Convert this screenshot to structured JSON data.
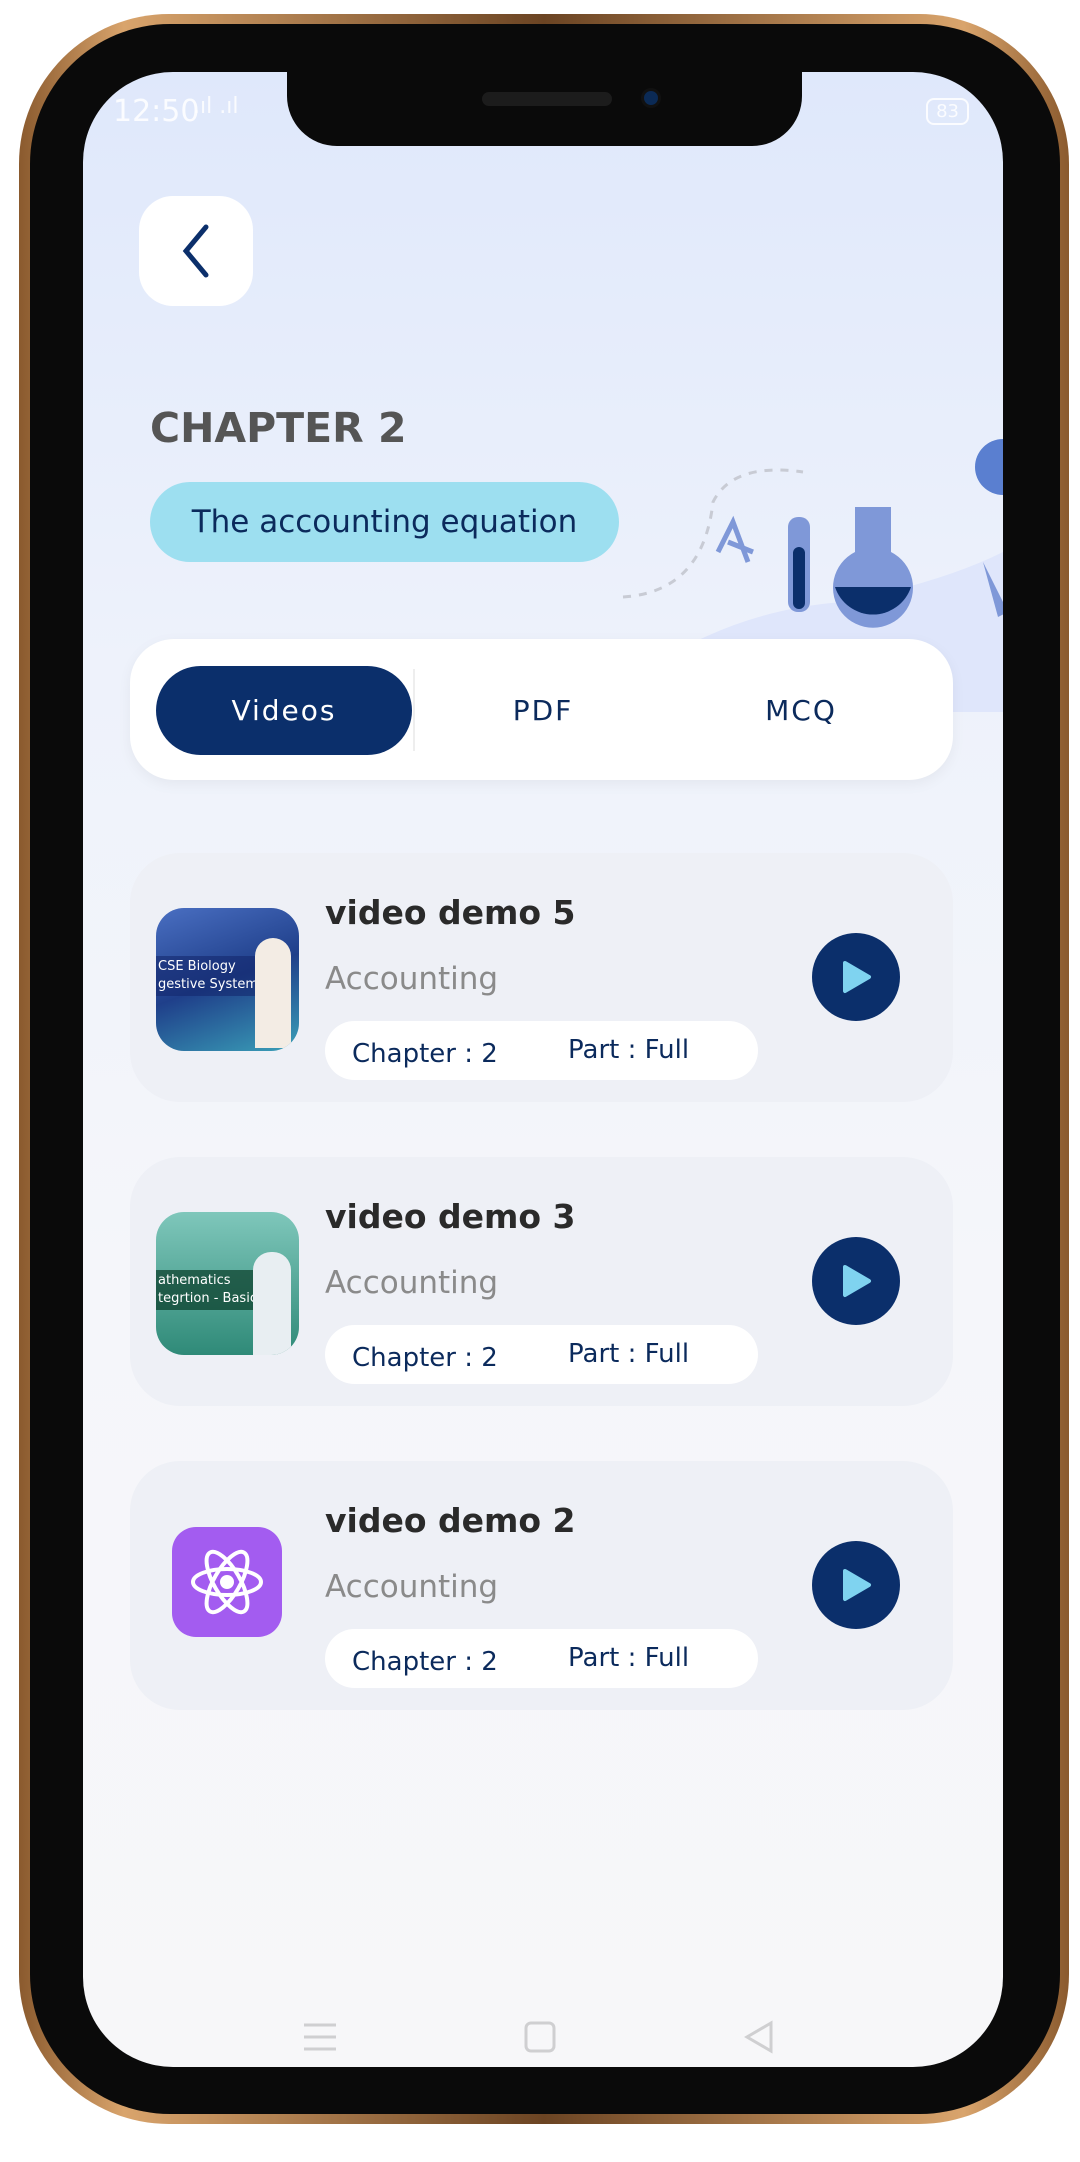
{
  "status_bar": {
    "time": "12:50",
    "battery": "83"
  },
  "header": {
    "chapter": "CHAPTER 2",
    "topic": "The accounting equation"
  },
  "tabs": [
    {
      "label": "Videos",
      "active": true
    },
    {
      "label": "PDF",
      "active": false
    },
    {
      "label": "MCQ",
      "active": false
    }
  ],
  "videos": [
    {
      "title": "video demo 5",
      "subject": "Accounting",
      "chapter": "Chapter : 2",
      "part": "Part : Full",
      "thumb_text": [
        "CSE Biology",
        "gestive System"
      ]
    },
    {
      "title": "video demo 3",
      "subject": "Accounting",
      "chapter": "Chapter : 2",
      "part": "Part : Full",
      "thumb_text": [
        "athematics",
        "tegrtion - Basics"
      ]
    },
    {
      "title": "video demo 2",
      "subject": "Accounting",
      "chapter": "Chapter : 2",
      "part": "Part : Full",
      "thumb_icon": "atom-icon"
    }
  ],
  "colors": {
    "primary": "#0b2f6b",
    "pill": "#9ddff0",
    "play_triangle": "#7fd3f0",
    "atom_bg": "#a35cf0"
  }
}
